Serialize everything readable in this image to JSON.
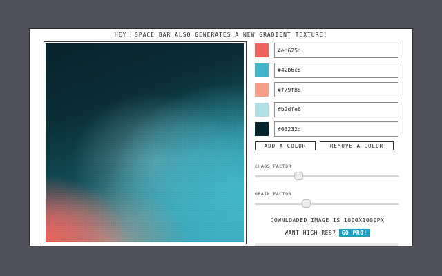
{
  "banner": "HEY! SPACE BAR ALSO GENERATES A NEW GRADIENT TEXTURE!",
  "colors": [
    {
      "hex": "#ed625d",
      "swatch": "#ed625d"
    },
    {
      "hex": "#42b6c8",
      "swatch": "#42b6c8"
    },
    {
      "hex": "#f79f88",
      "swatch": "#f79f88"
    },
    {
      "hex": "#b2dfe6",
      "swatch": "#b2dfe6"
    },
    {
      "hex": "#03232d",
      "swatch": "#03232d"
    }
  ],
  "buttons": {
    "add": "ADD A COLOR",
    "remove": "REMOVE A COLOR"
  },
  "sliders": {
    "chaos": {
      "label": "CHAOS FACTOR",
      "value": 0.3
    },
    "grain": {
      "label": "GRAIN FACTOR",
      "value": 0.35
    }
  },
  "info": {
    "download": "DOWNLOADED IMAGE IS 1000X1000PX",
    "want_high_res": "WANT HIGH-RES?",
    "go_pro": "GO PRO!"
  },
  "accent_color": "#1aa0c2"
}
